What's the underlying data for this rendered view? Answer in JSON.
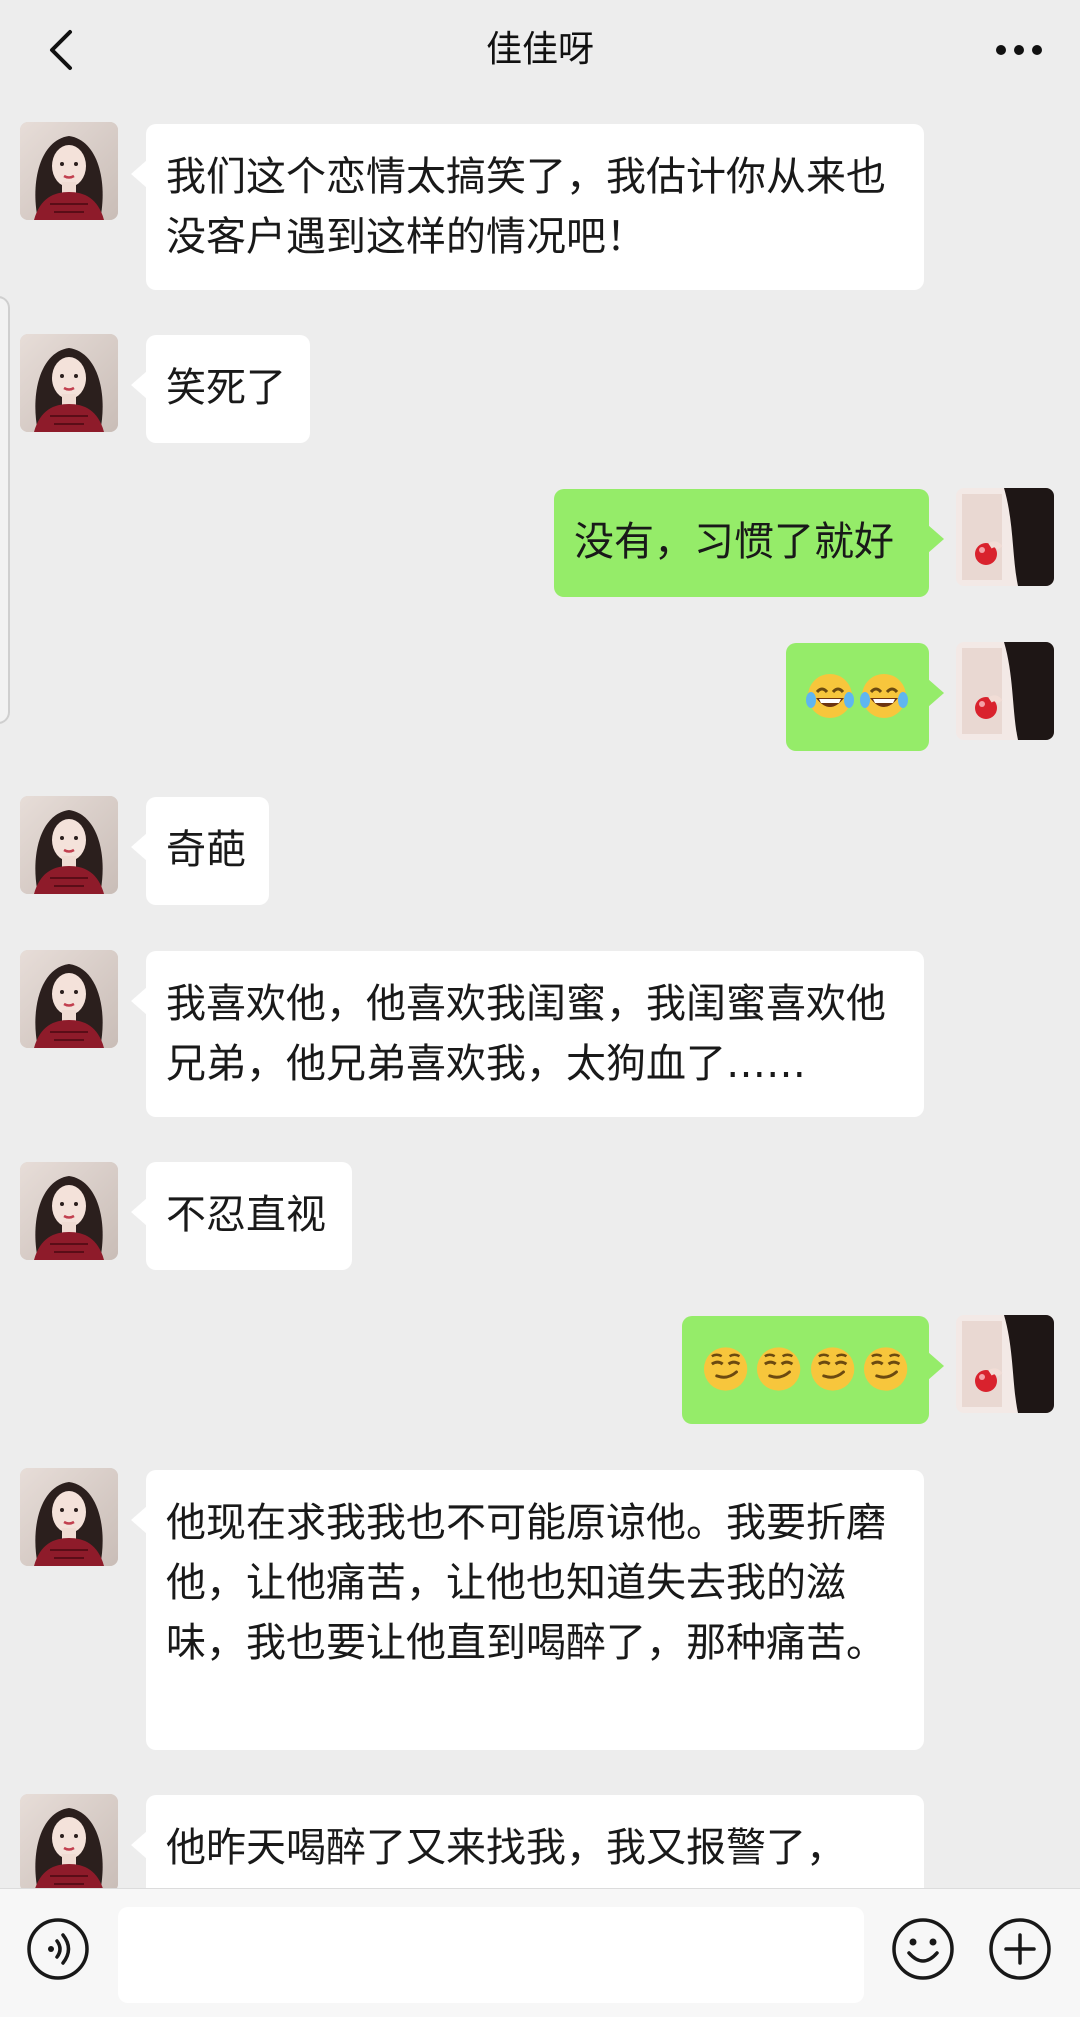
{
  "header": {
    "title": "佳佳呀",
    "back_icon": "chevron-left-icon",
    "more_icon": "more-dots-icon"
  },
  "messages": [
    {
      "side": "in",
      "text": "我们这个恋情太搞笑了，我估计你从来也没客户遇到这样的情况吧！"
    },
    {
      "side": "in",
      "text": "笑死了"
    },
    {
      "side": "out",
      "text": "没有，习惯了就好"
    },
    {
      "side": "out",
      "emoji": [
        "tears-of-joy",
        "tears-of-joy"
      ]
    },
    {
      "side": "in",
      "text": "奇葩"
    },
    {
      "side": "in",
      "text": "我喜欢他，他喜欢我闺蜜，我闺蜜喜欢他兄弟，他兄弟喜欢我，太狗血了……"
    },
    {
      "side": "in",
      "text": "不忍直视"
    },
    {
      "side": "out",
      "emoji": [
        "smirk",
        "smirk",
        "smirk",
        "smirk"
      ]
    },
    {
      "side": "in",
      "text": "他现在求我我也不可能原谅他。我要折磨他，让他痛苦，让他也知道失去我的滋味，我也要让他直到喝醉了，那种痛苦。"
    },
    {
      "side": "in",
      "text": "他昨天喝醉了又来找我，我又报警了，"
    }
  ],
  "input_bar": {
    "voice_icon": "voice-icon",
    "text_value": "",
    "emoji_icon": "emoji-smile-icon",
    "plus_icon": "plus-circle-icon"
  },
  "colors": {
    "background": "#ededed",
    "bubble_in": "#ffffff",
    "bubble_out": "#95ec69",
    "text": "#191919"
  }
}
